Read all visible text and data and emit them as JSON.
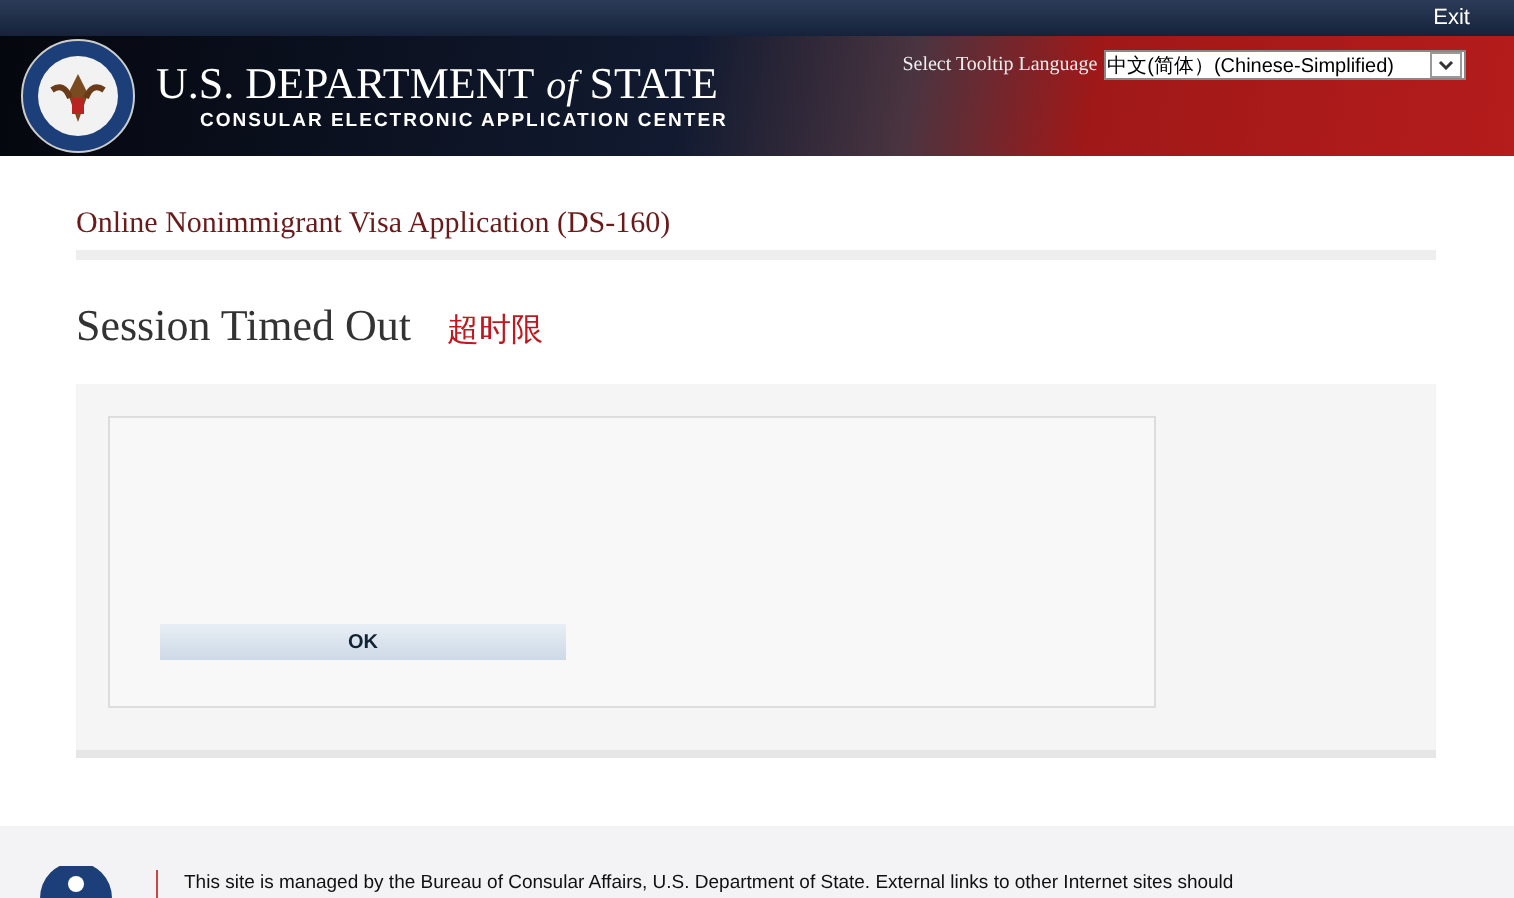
{
  "top_bar": {
    "exit_link": "Exit"
  },
  "banner": {
    "title_main": "U.S. DEPARTMENT",
    "title_of": "of",
    "title_state": "STATE",
    "subtitle": "CONSULAR ELECTRONIC APPLICATION CENTER",
    "language_label": "Select Tooltip Language",
    "language_value": "中文(简体）(Chinese-Simplified)"
  },
  "page": {
    "application_title": "Online Nonimmigrant Visa Application (DS-160)",
    "heading": "Session Timed Out",
    "heading_translation": "超时限"
  },
  "dialog": {
    "button": "OK"
  },
  "footer": {
    "text": "This site is managed by the Bureau of Consular Affairs, U.S. Department of State. External links to other Internet sites should"
  }
}
